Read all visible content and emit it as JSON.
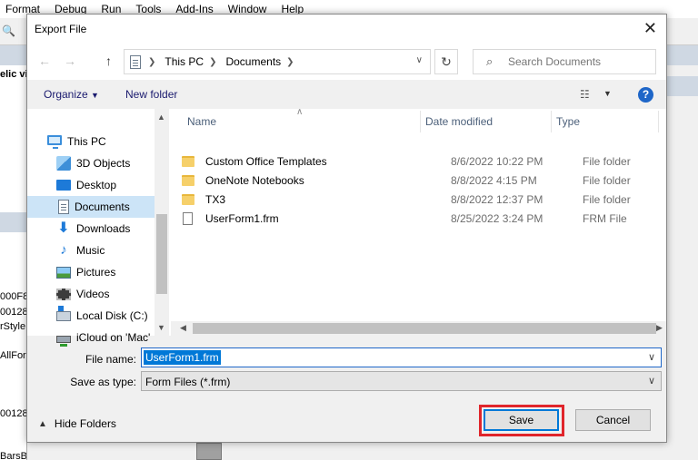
{
  "background": {
    "menu": [
      "Format",
      "Debug",
      "Run",
      "Tools",
      "Add-Ins",
      "Window",
      "Help"
    ],
    "left_fragments": [
      "elic vi",
      "000F8",
      "00128",
      "rStyle",
      "AllForm",
      "00128",
      "BarsBoth"
    ]
  },
  "dialog": {
    "title": "Export File",
    "address": {
      "segments": [
        "This PC",
        "Documents"
      ]
    },
    "search_placeholder": "Search Documents",
    "organize_label": "Organize",
    "new_folder_label": "New folder",
    "help_label": "?",
    "nav_items": [
      {
        "label": "This PC",
        "icon": "computer-icon"
      },
      {
        "label": "3D Objects",
        "icon": "cube-icon"
      },
      {
        "label": "Desktop",
        "icon": "desktop-icon"
      },
      {
        "label": "Documents",
        "icon": "documents-icon",
        "selected": true
      },
      {
        "label": "Downloads",
        "icon": "download-icon"
      },
      {
        "label": "Music",
        "icon": "music-icon"
      },
      {
        "label": "Pictures",
        "icon": "pictures-icon"
      },
      {
        "label": "Videos",
        "icon": "videos-icon"
      },
      {
        "label": "Local Disk (C:)",
        "icon": "disk-icon"
      },
      {
        "label": "iCloud on 'Mac'",
        "icon": "network-drive-icon"
      }
    ],
    "columns": {
      "name": "Name",
      "date": "Date modified",
      "type": "Type"
    },
    "files": [
      {
        "name": "Custom Office Templates",
        "date": "8/6/2022 10:22 PM",
        "type": "File folder",
        "icon": "folder-icon"
      },
      {
        "name": "OneNote Notebooks",
        "date": "8/8/2022 4:15 PM",
        "type": "File folder",
        "icon": "folder-icon"
      },
      {
        "name": "TX3",
        "date": "8/8/2022 12:37 PM",
        "type": "File folder",
        "icon": "folder-icon"
      },
      {
        "name": "UserForm1.frm",
        "date": "8/25/2022 3:24 PM",
        "type": "FRM File",
        "icon": "file-icon"
      }
    ],
    "file_name_label": "File name:",
    "file_name_value": "UserForm1.frm",
    "save_type_label": "Save as type:",
    "save_type_value": "Form Files (*.frm)",
    "hide_folders_label": "Hide Folders",
    "save_label": "Save",
    "cancel_label": "Cancel"
  },
  "colors": {
    "accent": "#0078d7",
    "highlight": "#e0252b",
    "selected_nav": "#cce4f7"
  }
}
